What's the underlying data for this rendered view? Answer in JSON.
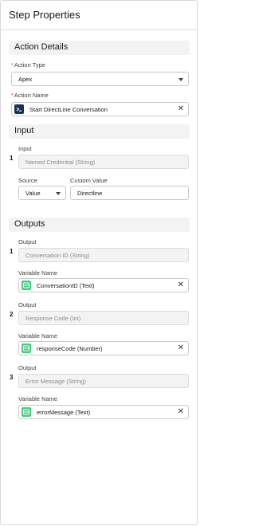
{
  "panel": {
    "title": "Step Properties"
  },
  "action_details": {
    "heading": "Action Details",
    "action_type": {
      "label": "Action Type",
      "value": "Apex"
    },
    "action_name": {
      "label": "Action Name",
      "value": "Start DirectLine Conversation"
    }
  },
  "input": {
    "heading": "Input",
    "items": [
      {
        "number": "1",
        "input_label": "Input",
        "input_value": "Named Credential (String)",
        "source_label": "Source",
        "source_value": "Value",
        "custom_label": "Custom Value",
        "custom_value": "Directline"
      }
    ]
  },
  "outputs": {
    "heading": "Outputs",
    "items": [
      {
        "number": "1",
        "output_label": "Output",
        "output_value": "Conversation ID (String)",
        "var_label": "Variable Name",
        "var_value": "ConversationID (Text)"
      },
      {
        "number": "2",
        "output_label": "Output",
        "output_value": "Response Code (Int)",
        "var_label": "Variable Name",
        "var_value": "responseCode (Number)"
      },
      {
        "number": "3",
        "output_label": "Output",
        "output_value": "Error Message (String)",
        "var_label": "Variable Name",
        "var_value": "errorMessage (Text)"
      }
    ]
  },
  "required_marker": "*",
  "clear_glyph": "✕",
  "icons": {
    "apex": "apex-action-icon",
    "variable": "variable-icon"
  },
  "colors": {
    "required": "#c23934",
    "apex_icon_bg": "#16325c",
    "variable_icon_bg": "#4bca81"
  }
}
